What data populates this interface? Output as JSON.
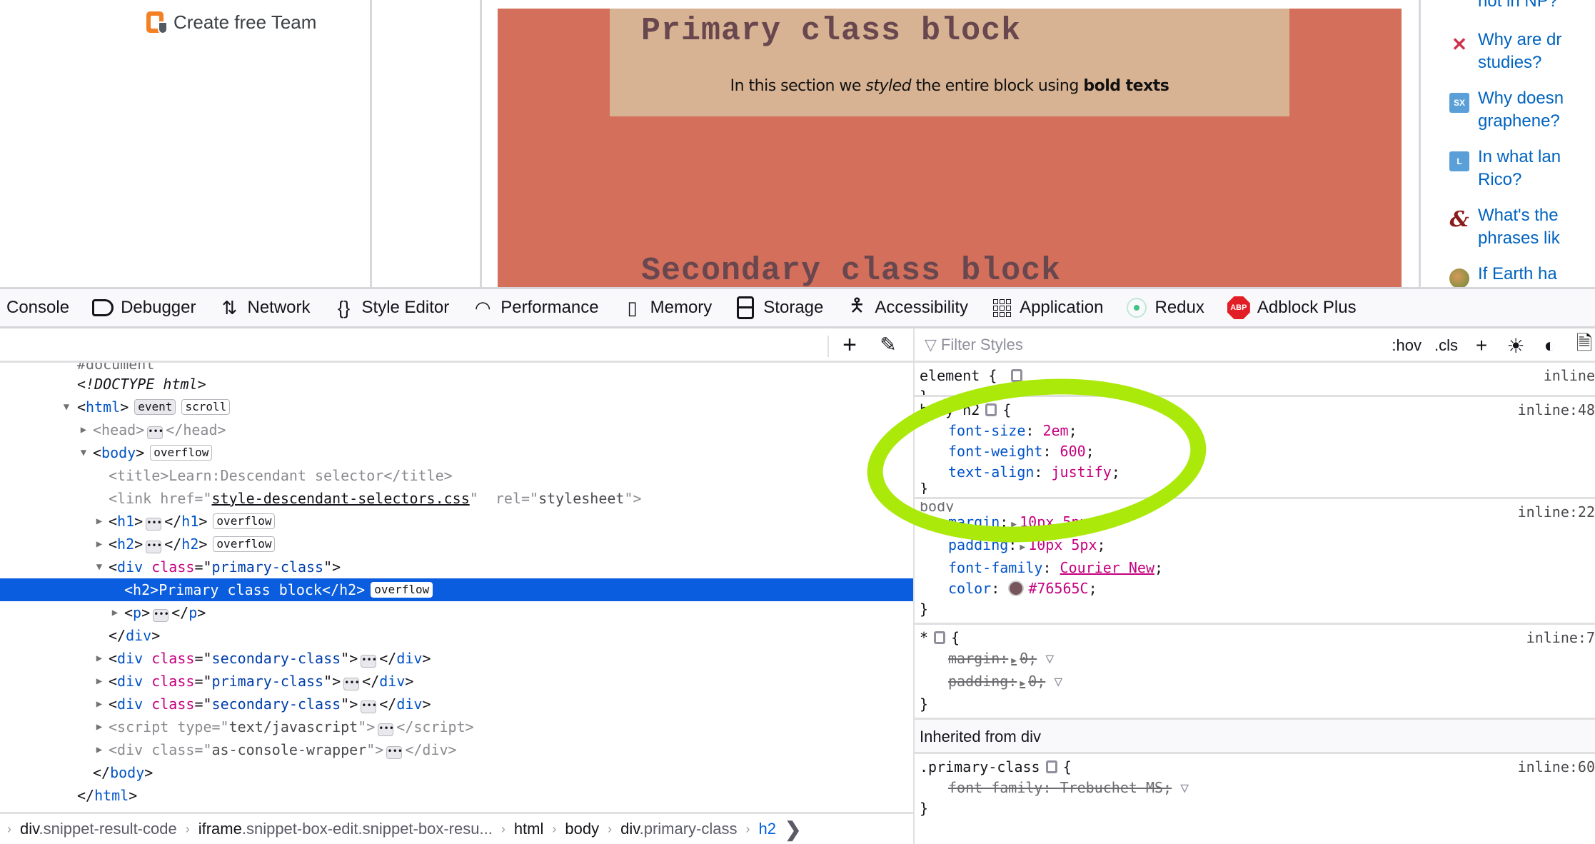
{
  "page": {
    "team_link": "Create free Team",
    "primary_heading": "Primary class block",
    "primary_paragraph": {
      "before": "In this section we ",
      "italic": "styled",
      "middle": " the entire block using ",
      "bold": "bold texts"
    },
    "secondary_heading": "Secondary class block",
    "hot_questions": [
      {
        "icon": "cs-theory-icon",
        "label": "not in NP?"
      },
      {
        "icon": "drug-studies-icon",
        "label": "Why are dr",
        "line2": "studies?"
      },
      {
        "icon": "sx-site-icon",
        "icon_text": "SX",
        "label": "Why doesn",
        "line2": "graphene?"
      },
      {
        "icon": "language-site-icon",
        "icon_text": "L",
        "label": "In what lan",
        "line2": "Rico?"
      },
      {
        "icon": "ampersand-icon",
        "icon_text": "&",
        "label": "What's the",
        "line2": "phrases lik"
      },
      {
        "icon": "worldbuilding-icon",
        "label": "If Earth ha"
      }
    ]
  },
  "devtools": {
    "tabs": [
      {
        "label": "Console",
        "icon": "console-icon"
      },
      {
        "label": "Debugger",
        "icon": "debugger-icon"
      },
      {
        "label": "Network",
        "icon": "network-icon"
      },
      {
        "label": "Style Editor",
        "icon": "style-editor-icon"
      },
      {
        "label": "Performance",
        "icon": "performance-icon"
      },
      {
        "label": "Memory",
        "icon": "memory-icon"
      },
      {
        "label": "Storage",
        "icon": "storage-icon"
      },
      {
        "label": "Accessibility",
        "icon": "accessibility-icon"
      },
      {
        "label": "Application",
        "icon": "application-icon"
      },
      {
        "label": "Redux",
        "icon": "redux-icon"
      },
      {
        "label": "Adblock Plus",
        "icon": "adblock-plus-icon",
        "icon_text": "ABP"
      }
    ],
    "markup": {
      "partial_top": "#document",
      "doctype": "<!DOCTYPE html>",
      "badges": {
        "event": "event",
        "scroll": "scroll",
        "overflow": "overflow"
      },
      "title_text": "Learn:Descendant selector",
      "link_href": "style-descendant-selectors.css",
      "link_rel": "stylesheet",
      "selected_h2_text": "Primary class block",
      "primary_class": "primary-class",
      "secondary_class": "secondary-class",
      "script_type": "text/javascript",
      "console_wrapper_class": "as-console-wrapper"
    },
    "breadcrumbs": [
      {
        "tag": "div",
        "cls": ".snippet-result-code"
      },
      {
        "tag": "iframe",
        "cls": ".snippet-box-edit.snippet-box-resu..."
      },
      {
        "tag": "html",
        "cls": ""
      },
      {
        "tag": "body",
        "cls": ""
      },
      {
        "tag": "div",
        "cls": ".primary-class"
      },
      {
        "tag": "h2",
        "cls": ""
      }
    ],
    "rules_toolbar": {
      "filter_placeholder": "Filter Styles",
      "hov": ":hov",
      "cls": ".cls"
    },
    "rules": {
      "element": {
        "selector": "element",
        "source": "inline"
      },
      "body_h2": {
        "selector": "body h2",
        "source": "inline:48",
        "decls": [
          {
            "prop": "font-size",
            "value": "2em"
          },
          {
            "prop": "font-weight",
            "value": "600"
          },
          {
            "prop": "text-align",
            "value": "justify"
          }
        ]
      },
      "body_partial": {
        "selector_visible": "body",
        "source": "inline:22",
        "decls": [
          {
            "prop": "margin",
            "value": "10px 5px"
          },
          {
            "prop": "padding",
            "value": "10px 5px"
          },
          {
            "prop": "font-family",
            "value": "Courier New"
          },
          {
            "prop": "color",
            "value": "#76565C"
          }
        ]
      },
      "universal": {
        "selector": "*",
        "source": "inline:7",
        "decls": [
          {
            "prop": "margin",
            "value": "0"
          },
          {
            "prop": "padding",
            "value": "0"
          }
        ]
      },
      "inherited_header": "Inherited from div",
      "primary_class": {
        "selector": ".primary-class",
        "source": "inline:60",
        "decls": [
          {
            "prop": "font-family",
            "value": "Trebuchet MS"
          }
        ]
      }
    },
    "colors": {
      "selection": "#0a5dde",
      "annotation_ellipse": "#abe90b",
      "swatch": "#76565C"
    }
  }
}
